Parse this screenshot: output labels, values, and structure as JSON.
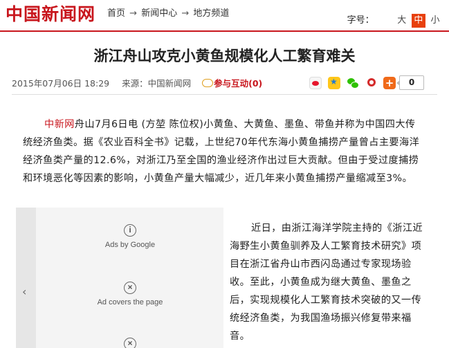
{
  "site": {
    "logo": "中国新闻网",
    "breadcrumb": [
      "首页",
      "新闻中心",
      "地方频道"
    ],
    "breadcrumb_sep": "→"
  },
  "font_size": {
    "label": "字号：",
    "options": [
      "大",
      "中",
      "小"
    ],
    "selected": "中"
  },
  "article": {
    "title": "浙江舟山攻克小黄鱼规模化人工繁育难关",
    "datetime": "2015年07月06日 18:29",
    "source": "来源：中国新闻网",
    "interact_label": "参与互动",
    "interact_count": "(0)",
    "share_count": "0",
    "para1_agency": "中新网",
    "para1_text": "舟山7月6日电 (方堃 陈位权)小黄鱼、大黄鱼、墨鱼、带鱼并称为中国四大传统经济鱼类。据《农业百科全书》记载，上世纪70年代东海小黄鱼捕捞产量曾占主要海洋经济鱼类产量的12.6%，对浙江乃至全国的渔业经济作出过巨大贡献。但由于受过度捕捞和环境恶化等因素的影响，小黄鱼产量大幅减少，近几年来小黄鱼捕捞产量缩减至3%。",
    "para2_text": "近日，由浙江海洋学院主持的《浙江近海野生小黄鱼驯养及人工繁育技术研究》项目在浙江省舟山市西闪岛通过专家现场验收。至此，小黄鱼成为继大黄鱼、墨鱼之后，实现规模化人工繁育技术突破的又一传统经济鱼类，为我国渔场振兴修复带来福音。"
  },
  "ad": {
    "item1_label": "Ads by Google",
    "item2_label": "Ad covers the page",
    "item1_icon": "i",
    "item2_icon": "×",
    "item3_icon": "×",
    "prev_arrow": "‹"
  },
  "colors": {
    "brand_red": "#c8161d",
    "font_size_active": "#e8400c"
  }
}
